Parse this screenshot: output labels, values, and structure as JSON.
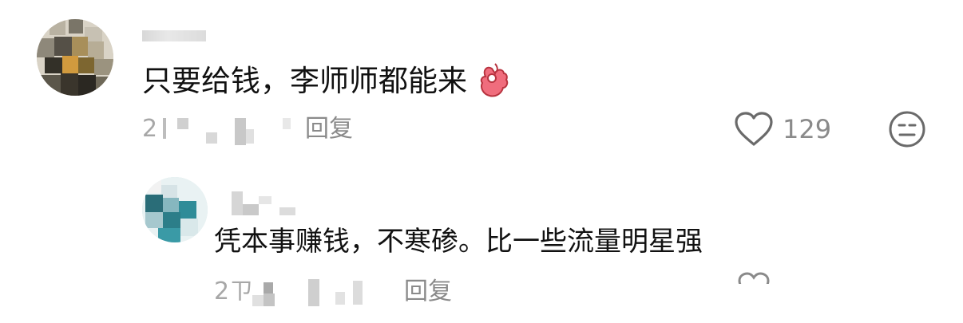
{
  "comment": {
    "text": "只要给钱，李师师都能来",
    "emoji_icon": "ok-hand-icon",
    "date_prefix": "2",
    "reply_label": "回复",
    "like_icon": "heart-outline-icon",
    "like_count": "129",
    "dislike_icon": "meh-face-icon"
  },
  "reply": {
    "text": "凭本事赚钱，不寒碜。比一些流量明星强",
    "date_prefix": "2ㄗ",
    "reply_label": "回复"
  },
  "colors": {
    "text": "#111111",
    "meta": "#8a8a8a",
    "placeholder": "#cfcfcf"
  }
}
